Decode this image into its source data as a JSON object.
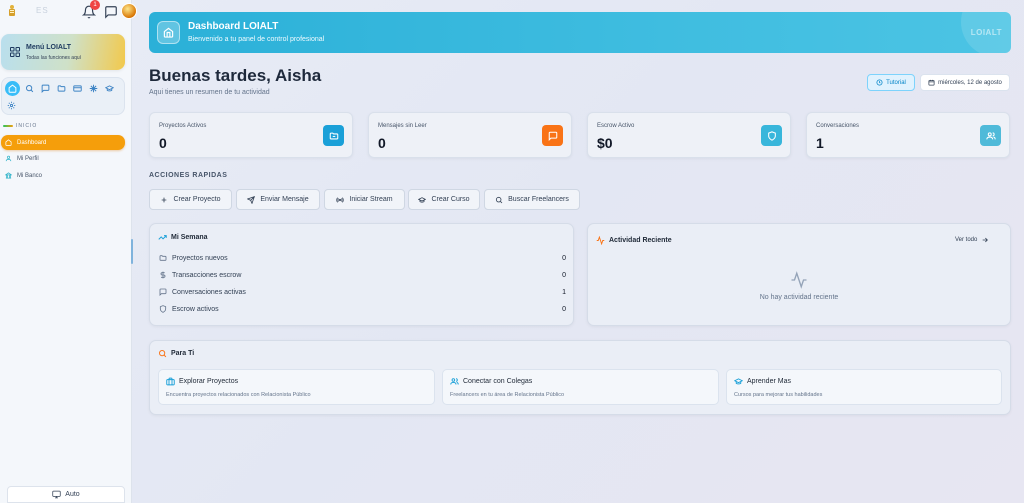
{
  "colors": {
    "accent_blue": "#2bb0d8",
    "nav_active": "#f59e0b",
    "stat_icon_blue": "#1aa0d8",
    "stat_icon_orange": "#f97316",
    "stat_icon_cyan": "#38b6db",
    "stat_icon_teal": "#4fbad9"
  },
  "topbar": {
    "ghost_text": "ES",
    "notification_count": "1"
  },
  "sidebar": {
    "menu_title": "Menú LOIALT",
    "menu_subtitle": "Todas las funciones aquí",
    "quick_icons": [
      "home-icon",
      "search-icon",
      "chat-icon",
      "folder-icon",
      "card-icon",
      "sparkle-icon",
      "graduation-icon",
      "gear-icon"
    ],
    "section_label": "INICIO",
    "items": [
      {
        "label": "Dashboard",
        "icon": "home-icon",
        "active": true
      },
      {
        "label": "Mi Perfil",
        "icon": "user-icon",
        "active": false
      },
      {
        "label": "Mi Banco",
        "icon": "bank-icon",
        "active": false
      }
    ],
    "theme_label": "Auto"
  },
  "banner": {
    "title": "Dashboard LOIALT",
    "subtitle": "Bienvenido a tu panel de control profesional",
    "watermark": "LOIALT"
  },
  "header": {
    "greeting": "Buenas tardes, Aisha",
    "subtitle": "Aqui tienes un resumen de tu actividad",
    "tutorial_label": "Tutorial",
    "date_label": "miércoles, 12 de agosto"
  },
  "stats": [
    {
      "label": "Proyectos Activos",
      "value": "0",
      "icon": "folder-icon"
    },
    {
      "label": "Mensajes sin Leer",
      "value": "0",
      "icon": "message-icon"
    },
    {
      "label": "Escrow Activo",
      "value": "$0",
      "icon": "shield-icon"
    },
    {
      "label": "Conversaciones",
      "value": "1",
      "icon": "users-icon"
    }
  ],
  "quick_actions": {
    "title": "ACCIONES RAPIDAS",
    "items": [
      {
        "label": "Crear Proyecto",
        "icon": "plus-icon"
      },
      {
        "label": "Enviar Mensaje",
        "icon": "send-icon"
      },
      {
        "label": "Iniciar Stream",
        "icon": "broadcast-icon"
      },
      {
        "label": "Crear Curso",
        "icon": "graduation-icon"
      },
      {
        "label": "Buscar Freelancers",
        "icon": "search-icon"
      }
    ]
  },
  "week": {
    "title": "Mi Semana",
    "rows": [
      {
        "label": "Proyectos nuevos",
        "value": "0",
        "icon": "folder-icon"
      },
      {
        "label": "Transacciones escrow",
        "value": "0",
        "icon": "dollar-icon"
      },
      {
        "label": "Conversaciones activas",
        "value": "1",
        "icon": "message-icon"
      },
      {
        "label": "Escrow activos",
        "value": "0",
        "icon": "shield-icon"
      }
    ]
  },
  "activity": {
    "title": "Actividad Reciente",
    "view_all": "Ver todo",
    "empty_text": "No hay actividad reciente"
  },
  "for_you": {
    "title": "Para Ti",
    "cards": [
      {
        "title": "Explorar Proyectos",
        "desc": "Encuentra proyectos relacionados con Relacionista Público",
        "icon": "briefcase-icon"
      },
      {
        "title": "Conectar con Colegas",
        "desc": "Freelancers en tu área de Relacionista Público",
        "icon": "users-icon"
      },
      {
        "title": "Aprender Mas",
        "desc": "Cursos para mejorar tus habilidades",
        "icon": "graduation-icon"
      }
    ]
  }
}
